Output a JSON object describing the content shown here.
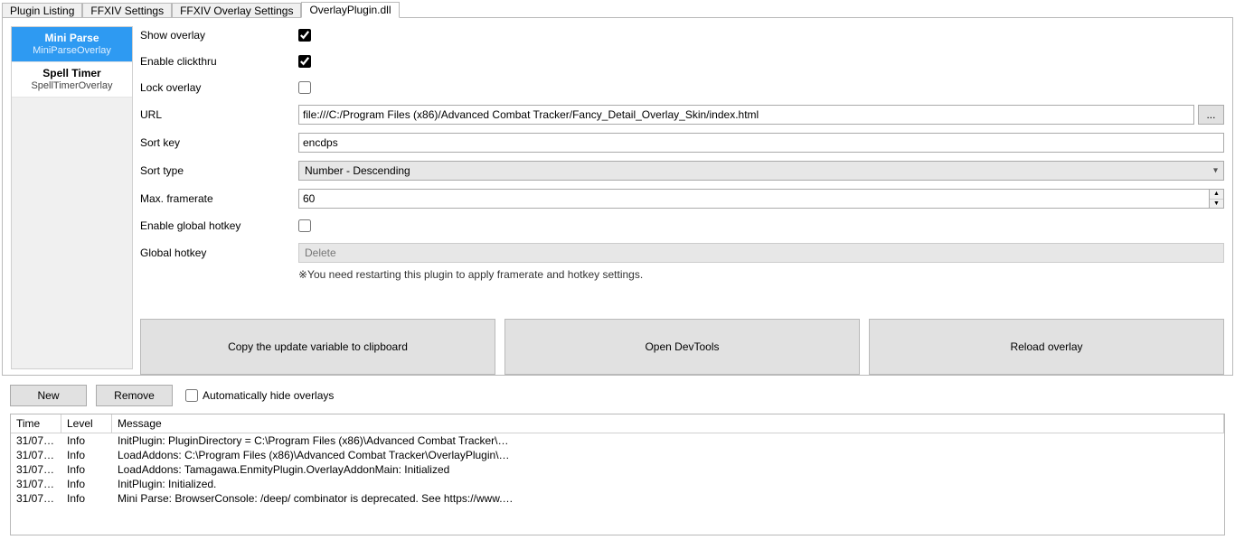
{
  "tabs": {
    "items": [
      {
        "label": "Plugin Listing"
      },
      {
        "label": "FFXIV Settings"
      },
      {
        "label": "FFXIV Overlay Settings"
      },
      {
        "label": "OverlayPlugin.dll"
      }
    ],
    "active_index": 3
  },
  "sidebar": {
    "items": [
      {
        "title": "Mini Parse",
        "subtitle": "MiniParseOverlay"
      },
      {
        "title": "Spell Timer",
        "subtitle": "SpellTimerOverlay"
      }
    ],
    "active_index": 0
  },
  "form": {
    "show_overlay_label": "Show overlay",
    "show_overlay_checked": true,
    "enable_clickthru_label": "Enable clickthru",
    "enable_clickthru_checked": true,
    "lock_overlay_label": "Lock overlay",
    "lock_overlay_checked": false,
    "url_label": "URL",
    "url_value": "file:///C:/Program Files (x86)/Advanced Combat Tracker/Fancy_Detail_Overlay_Skin/index.html",
    "url_browse_btn": "...",
    "sort_key_label": "Sort key",
    "sort_key_value": "encdps",
    "sort_type_label": "Sort type",
    "sort_type_value": "Number - Descending",
    "max_framerate_label": "Max. framerate",
    "max_framerate_value": "60",
    "enable_global_hotkey_label": "Enable global hotkey",
    "enable_global_hotkey_checked": false,
    "global_hotkey_label": "Global hotkey",
    "global_hotkey_value": "Delete",
    "note": "※You need restarting this plugin to apply framerate and hotkey settings."
  },
  "big_buttons": {
    "copy": "Copy the update variable to clipboard",
    "devtools": "Open DevTools",
    "reload": "Reload overlay"
  },
  "bottom_controls": {
    "new_btn": "New",
    "remove_btn": "Remove",
    "auto_hide_label": "Automatically hide overlays",
    "auto_hide_checked": false
  },
  "log": {
    "headers": {
      "time": "Time",
      "level": "Level",
      "message": "Message"
    },
    "rows": [
      {
        "time": "31/07/2...",
        "level": "Info",
        "message": "InitPlugin: PluginDirectory = C:\\Program Files (x86)\\Advanced Combat Tracker\\O..."
      },
      {
        "time": "31/07/2...",
        "level": "Info",
        "message": "LoadAddons: C:\\Program Files (x86)\\Advanced Combat Tracker\\OverlayPlugin\\a..."
      },
      {
        "time": "31/07/2...",
        "level": "Info",
        "message": "LoadAddons: Tamagawa.EnmityPlugin.OverlayAddonMain: Initialized"
      },
      {
        "time": "31/07/2...",
        "level": "Info",
        "message": "InitPlugin: Initialized."
      },
      {
        "time": "31/07/2...",
        "level": "Info",
        "message": "Mini Parse: BrowserConsole: /deep/ combinator is deprecated. See https://www.c..."
      }
    ]
  }
}
